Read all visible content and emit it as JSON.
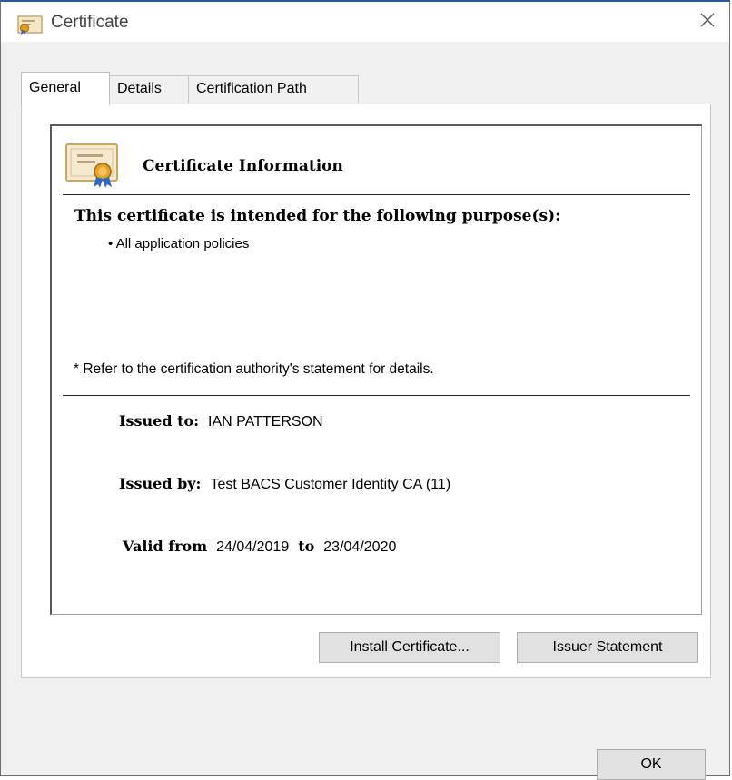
{
  "window": {
    "title": "Certificate",
    "icon": "certificate-icon",
    "close_icon": "close-icon"
  },
  "tabs": [
    {
      "label": "General",
      "active": true
    },
    {
      "label": "Details",
      "active": false
    },
    {
      "label": "Certification Path",
      "active": false
    }
  ],
  "general": {
    "heading": "Certificate Information",
    "purpose_heading": "This certificate is intended for the following purpose(s):",
    "purposes": [
      "• All application policies"
    ],
    "note": "* Refer to the certification authority's statement for details.",
    "issued_to_label": "Issued to:",
    "issued_to_value": "IAN PATTERSON",
    "issued_by_label": "Issued by:",
    "issued_by_value": "Test BACS Customer Identity CA (11)",
    "valid_from_label": "Valid from",
    "valid_from_value": "24/04/2019",
    "valid_to_label": "to",
    "valid_to_value": "23/04/2020"
  },
  "buttons": {
    "install": "Install Certificate...",
    "issuer": "Issuer Statement",
    "ok": "OK"
  }
}
